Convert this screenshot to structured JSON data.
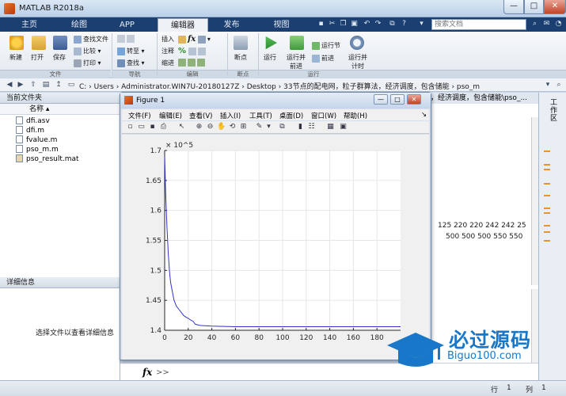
{
  "window": {
    "title": "MATLAB R2018a"
  },
  "tabs": [
    {
      "label": "主页"
    },
    {
      "label": "绘图"
    },
    {
      "label": "APP"
    },
    {
      "label": "编辑器"
    },
    {
      "label": "发布"
    },
    {
      "label": "视图"
    }
  ],
  "search": {
    "placeholder": "搜索文档"
  },
  "ribbon": {
    "file": {
      "new": "新建",
      "open": "打开",
      "save": "保存",
      "find_files": "查找文件",
      "compare": "比较",
      "print": "打印",
      "group": "文件"
    },
    "nav": {
      "goto": "转至",
      "find": "查找",
      "group": "导航"
    },
    "edit": {
      "insert": "插入",
      "comment": "注释",
      "indent": "缩进",
      "fx": "fx",
      "group": "编辑"
    },
    "breakpoints": {
      "label": "断点",
      "group": "断点"
    },
    "run": {
      "run": "运行",
      "run_advance_1": "运行并",
      "run_advance_2": "前进",
      "run_section": "运行节",
      "advance": "前进",
      "run_time_1": "运行并",
      "run_time_2": "计时",
      "group": "运行"
    }
  },
  "address": {
    "path": "C: › Users › Administrator.WIN7U-20180127Z › Desktop › 33节点的配电网，粒子群算法，经济调度，包含储能 › pso_m"
  },
  "current_folder": {
    "title": "当前文件夹",
    "col_name": "名称",
    "files": [
      {
        "name": "dfi.asv"
      },
      {
        "name": "dfi.m"
      },
      {
        "name": "fvalue.m"
      },
      {
        "name": "pso_m.m"
      },
      {
        "name": "pso_result.mat"
      }
    ]
  },
  "details": {
    "title": "详细信息",
    "message": "选择文件以查看详细信息"
  },
  "editor": {
    "header": "，经济调度，包含储能\\pso_...",
    "row1": "125  220  220  242  242     25",
    "row2": "500  500  500  550  550"
  },
  "right_panel": {
    "label": "工作区"
  },
  "figure": {
    "title": "Figure 1",
    "menu": [
      "文件(F)",
      "编辑(E)",
      "查看(V)",
      "插入(I)",
      "工具(T)",
      "桌面(D)",
      "窗口(W)",
      "帮助(H)"
    ],
    "buttons": {
      "min": "—",
      "max": "□",
      "close": "✕"
    }
  },
  "chart_data": {
    "type": "line",
    "title": "",
    "xlabel": "",
    "ylabel": "",
    "exponent_label": "× 10^5",
    "xlim": [
      0,
      200
    ],
    "ylim": [
      1.4,
      1.7
    ],
    "xticks": [
      0,
      20,
      40,
      60,
      80,
      100,
      120,
      140,
      160,
      180
    ],
    "yticks": [
      1.4,
      1.45,
      1.5,
      1.55,
      1.6,
      1.65,
      1.7
    ],
    "ytick_labels": [
      "1.4",
      "1.45",
      "1.5",
      "1.55",
      "1.6",
      "1.65",
      "1.7"
    ],
    "grid": true,
    "line_color": "#3333cc",
    "series": [
      {
        "x": [
          0,
          1,
          2,
          3,
          4,
          5,
          6,
          7,
          8,
          9,
          10,
          12,
          14,
          16,
          18,
          20,
          22,
          24,
          26,
          30,
          40,
          60,
          80,
          100,
          120,
          140,
          160,
          180,
          200
        ],
        "y": [
          1.69,
          1.62,
          1.57,
          1.53,
          1.5,
          1.48,
          1.47,
          1.46,
          1.45,
          1.445,
          1.44,
          1.435,
          1.43,
          1.425,
          1.422,
          1.42,
          1.417,
          1.415,
          1.41,
          1.408,
          1.407,
          1.406,
          1.406,
          1.406,
          1.406,
          1.406,
          1.406,
          1.406,
          1.406
        ]
      }
    ]
  },
  "command": {
    "fx": "fx",
    "prompt": ">>"
  },
  "status": {
    "row_label": "行",
    "row": "1",
    "col_label": "列",
    "col": "1"
  },
  "watermark": {
    "text": "必过源码",
    "url": "Biguo100.com"
  }
}
